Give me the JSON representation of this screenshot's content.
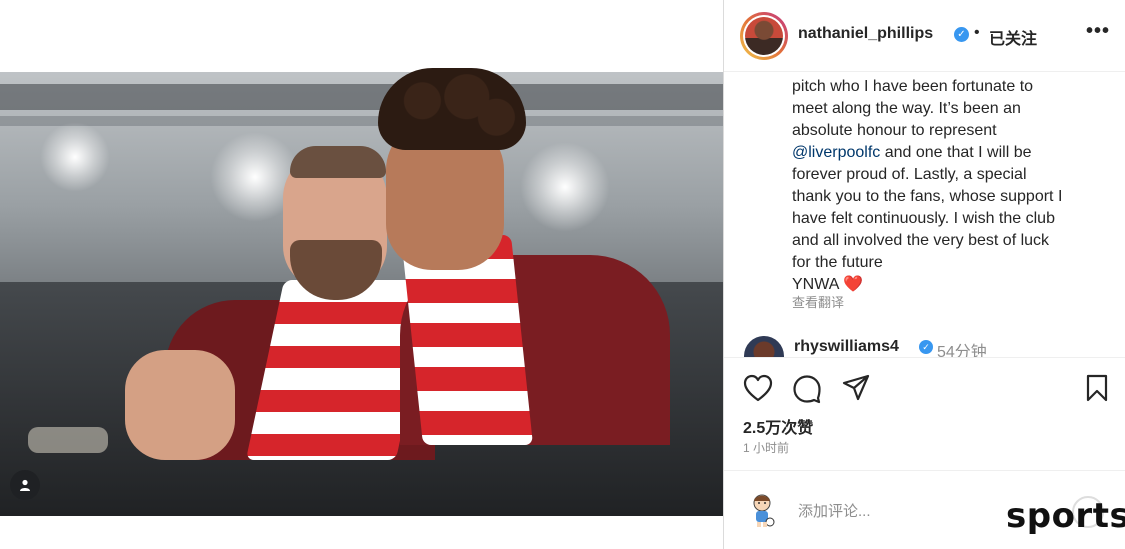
{
  "post": {
    "username": "nathaniel_phillips",
    "follow_status": "已关注",
    "caption_lines": [
      "pitch who I have been fortunate to",
      "meet along the way. It’s been an",
      "absolute honour to represent",
      "and one that I will be",
      "forever proud of. Lastly, a special",
      "thank you to the fans, whose support I",
      "have felt continuously. I wish the club",
      "and all involved the very best of luck",
      "for the future",
      "YNWA"
    ],
    "mention": "@liverpoolfc",
    "heart_emoji": "❤️",
    "translate_label": "查看翻译",
    "more_label": "•••",
    "separator": "•"
  },
  "comment": {
    "username": "rhyswilliams4",
    "time": "54分钟"
  },
  "stats": {
    "likes": "2.5万次赞",
    "posted_ago": "1 小时前"
  },
  "composer": {
    "placeholder": "添加评论..."
  },
  "watermark": "sports",
  "icons": {
    "verified": "verified-badge",
    "tag": "user-tag-icon",
    "like": "heart-icon",
    "comment": "comment-icon",
    "share": "share-icon",
    "save": "bookmark-icon",
    "emoji": "emoji-icon"
  },
  "colors": {
    "verified": "#3897f0",
    "mention": "#00376b",
    "secondary_text": "#8e8e8e",
    "liverpool_red": "#d6252b"
  }
}
